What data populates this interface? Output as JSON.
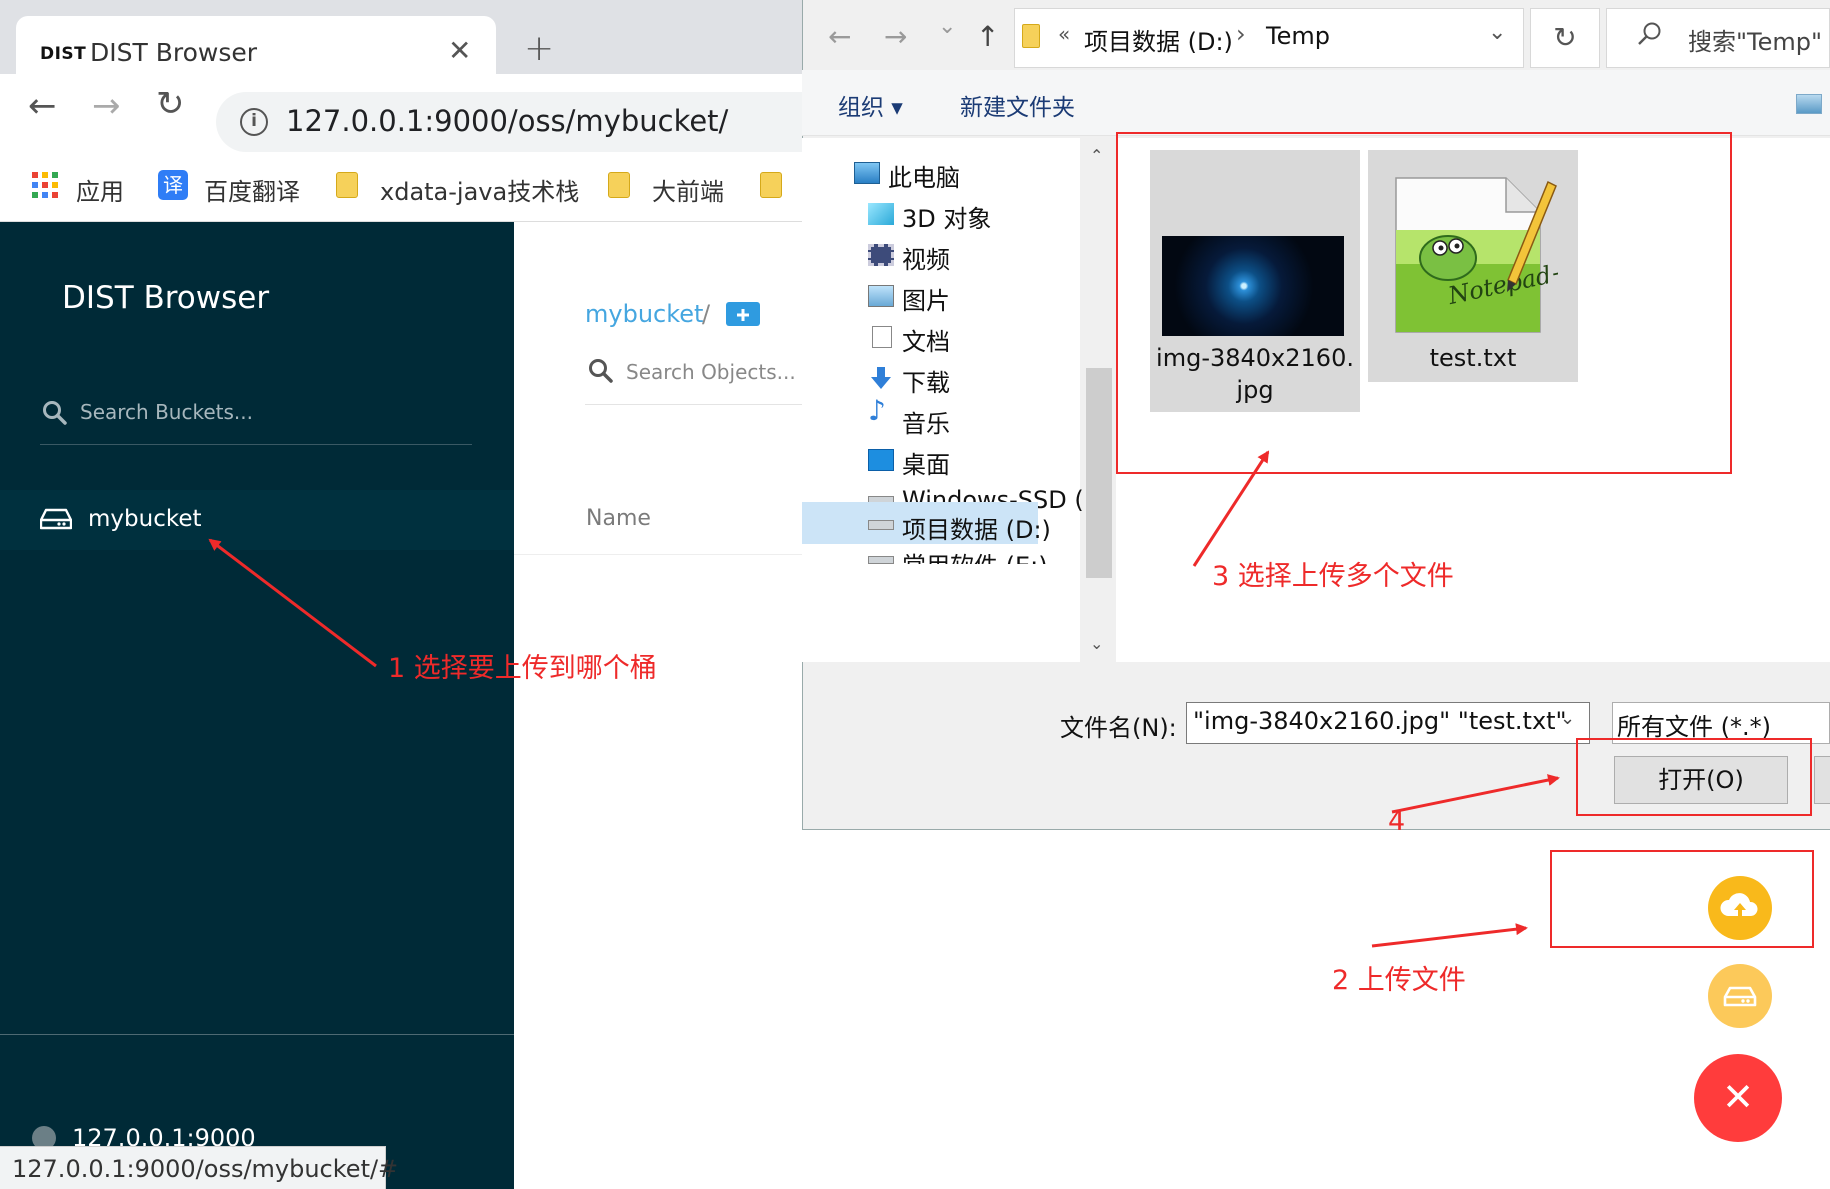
{
  "browser": {
    "tab_logo": "DIST",
    "tab_title": "DIST Browser",
    "tab_close": "✕",
    "new_tab": "+",
    "back": "←",
    "forward": "→",
    "reload": "↻",
    "url_info": "i",
    "url": "127.0.0.1:9000/oss/mybucket/",
    "bookmarks": [
      {
        "label": "应用",
        "icon": "apps-grid-icon"
      },
      {
        "label": "百度翻译",
        "icon": "translate-icon",
        "icon_text": "译"
      },
      {
        "label": "xdata-java技术栈",
        "icon": "folder-icon"
      },
      {
        "label": "大前端",
        "icon": "folder-icon"
      }
    ],
    "status_url": "127.0.0.1:9000/oss/mybucket/#"
  },
  "app": {
    "title": "DIST Browser",
    "search_buckets_placeholder": "Search Buckets...",
    "buckets": [
      "mybucket"
    ],
    "host": "127.0.0.1:9000",
    "breadcrumb_bucket": "mybucket",
    "breadcrumb_sep": "/",
    "search_objects_placeholder": "Search Objects...",
    "column_name": "Name",
    "fab_close": "✕",
    "colors": {
      "sidebar": "#002a37",
      "accent": "#45a6e0",
      "fab_upload": "#f9b91b",
      "fab_close": "#ff3c3c"
    }
  },
  "dialog": {
    "nav_back": "←",
    "nav_forward": "→",
    "nav_recent": "⌄",
    "nav_up": "↑",
    "address_prefix": "«",
    "address_part1": "项目数据 (D:)",
    "address_sep": "›",
    "address_part2": "Temp",
    "address_dropdown": "⌄",
    "refresh": "↻",
    "search_placeholder": "搜索\"Temp\"",
    "organize": "组织 ▾",
    "new_folder": "新建文件夹",
    "tree": [
      {
        "label": "此电脑",
        "icon": "computer-icon"
      },
      {
        "label": "3D 对象",
        "icon": "cube-icon"
      },
      {
        "label": "视频",
        "icon": "video-icon"
      },
      {
        "label": "图片",
        "icon": "picture-icon"
      },
      {
        "label": "文档",
        "icon": "document-icon"
      },
      {
        "label": "下载",
        "icon": "download-icon"
      },
      {
        "label": "音乐",
        "icon": "music-icon"
      },
      {
        "label": "桌面",
        "icon": "desktop-icon"
      },
      {
        "label": "Windows-SSD (",
        "icon": "windows-drive-icon"
      },
      {
        "label": "项目数据 (D:)",
        "icon": "drive-icon",
        "selected": true
      },
      {
        "label": "常用软件 (E:)",
        "icon": "drive-icon"
      }
    ],
    "files": [
      {
        "name_line1": "img-3840x2160.",
        "name_line2": "jpg",
        "icon": "image-thumbnail-icon"
      },
      {
        "name_line1": "test.txt",
        "icon": "notepad-plus-plus-icon"
      }
    ],
    "filename_label": "文件名(N):",
    "filename_value": "\"img-3840x2160.jpg\" \"test.txt\"",
    "filetype_value": "所有文件 (*.*)",
    "open_button": "打开(O)"
  },
  "annotations": {
    "step1": "1 选择要上传到哪个桶",
    "step2": "2 上传文件",
    "step3": "3 选择上传多个文件",
    "step4": "4",
    "color": "#ee2a2a"
  }
}
